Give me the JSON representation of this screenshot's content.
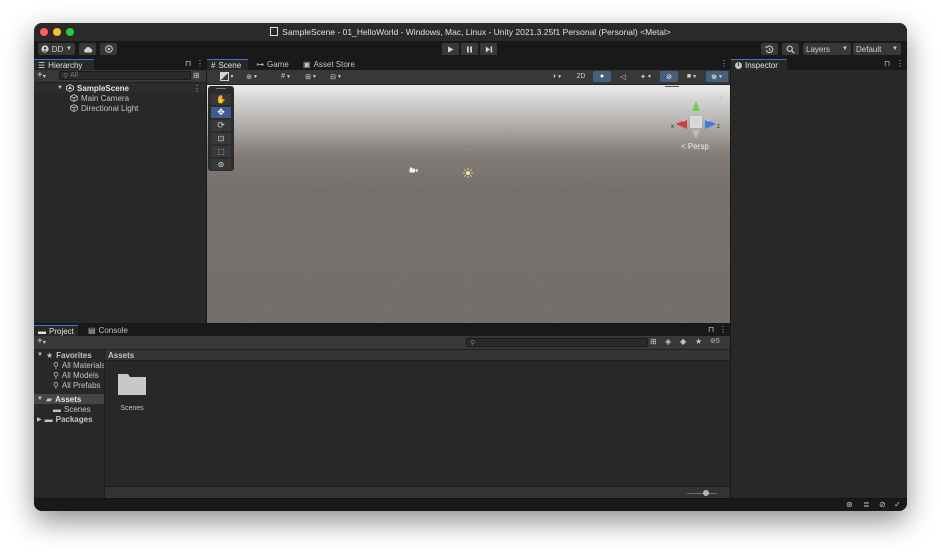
{
  "window": {
    "title": "SampleScene - 01_HelloWorld - Windows, Mac, Linux - Unity 2021.3.25f1 Personal (Personal) <Metal>"
  },
  "toolbar": {
    "account": "DD",
    "layers": "Layers",
    "layout": "Default"
  },
  "hierarchy": {
    "tab": "Hierarchy",
    "search_placeholder": "All",
    "scene": "SampleScene",
    "items": [
      "Main Camera",
      "Directional Light"
    ]
  },
  "scene_view": {
    "tabs": [
      "Scene",
      "Game",
      "Asset Store"
    ],
    "mode_2d": "2D",
    "persp_label": "< Persp",
    "gizmo_axes": {
      "x": "x",
      "y": "y",
      "z": "z"
    }
  },
  "inspector": {
    "tab": "Inspector"
  },
  "project": {
    "tabs": [
      "Project",
      "Console"
    ],
    "favorites_label": "Favorites",
    "favorites": [
      "All Materials",
      "All Models",
      "All Prefabs"
    ],
    "assets_label": "Assets",
    "assets_children": [
      "Scenes"
    ],
    "packages_label": "Packages",
    "breadcrumb": "Assets",
    "folder_name": "Scenes",
    "hidden_count": "5"
  },
  "colors": {
    "accent": "#3d74d6",
    "selection": "#3d5b8c",
    "panel": "#282828",
    "bar": "#383838"
  }
}
